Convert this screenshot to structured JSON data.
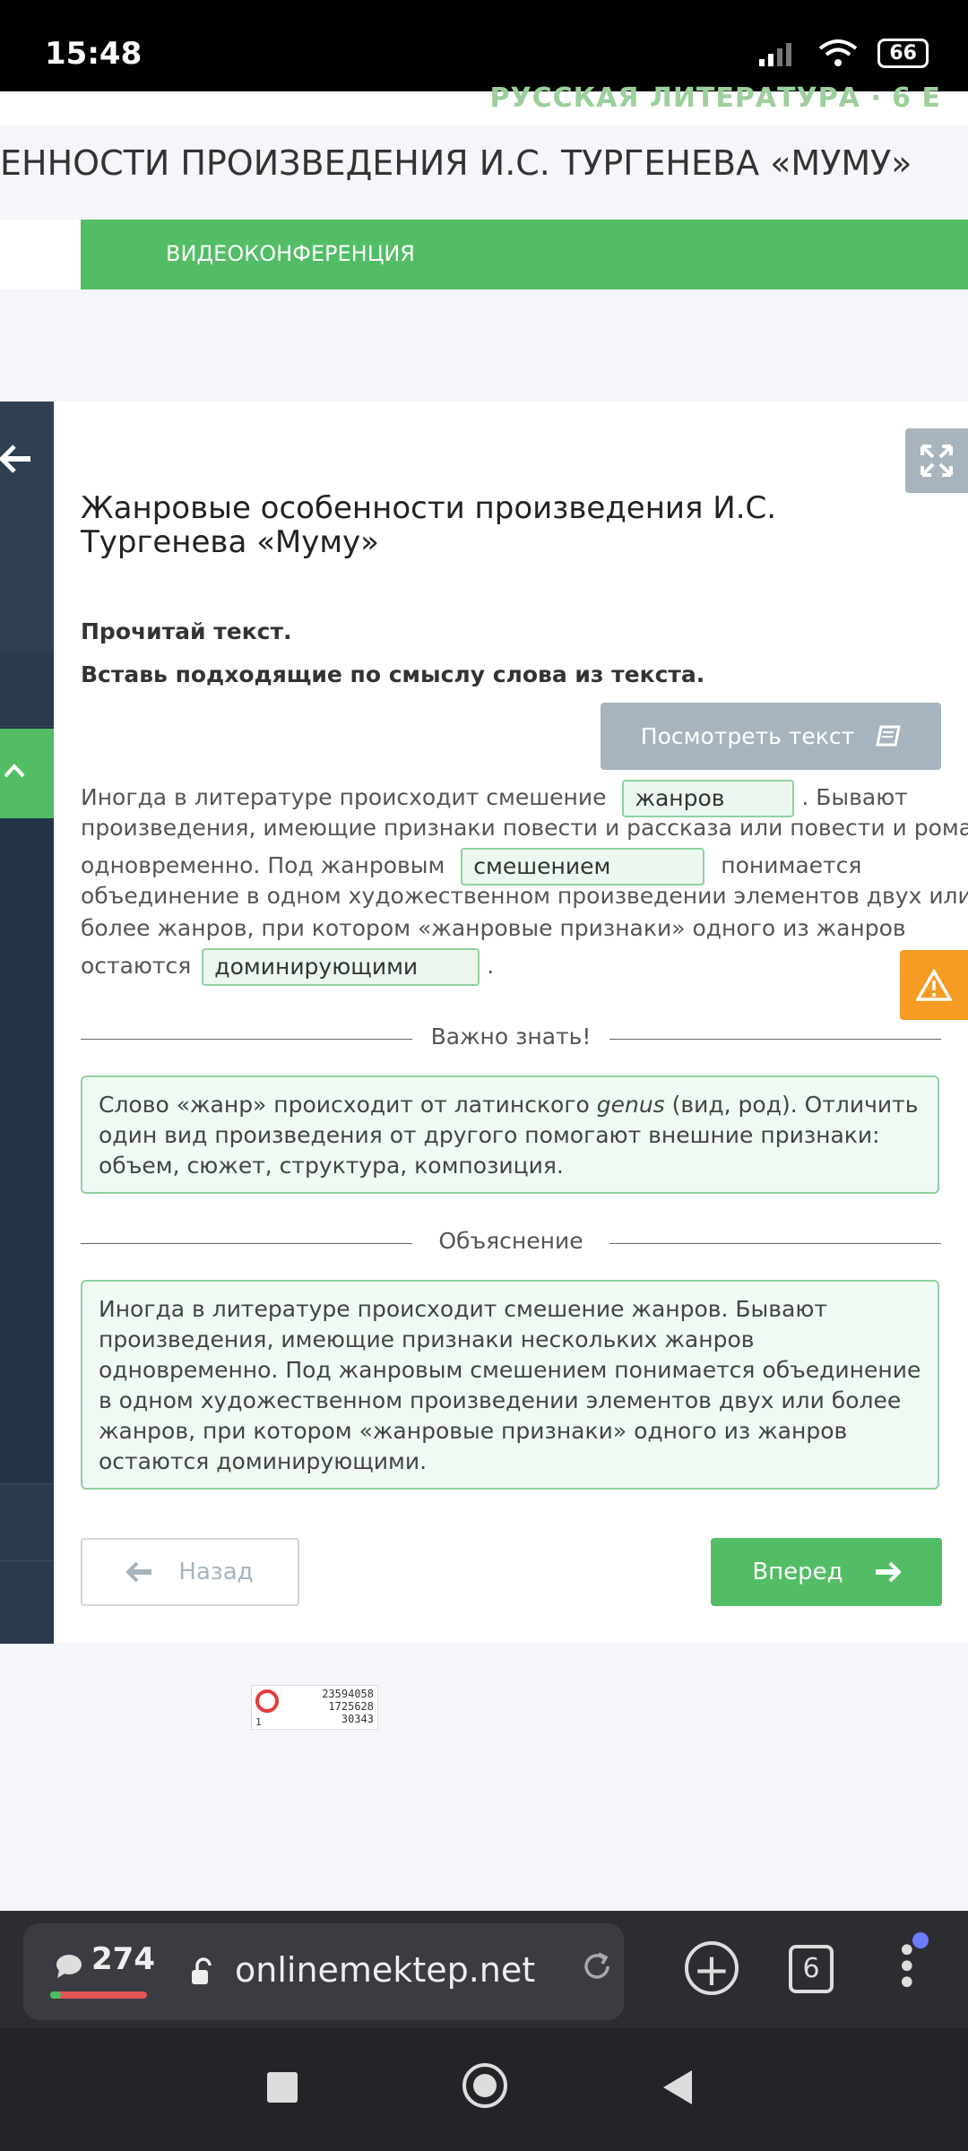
{
  "status": {
    "time": "15:48",
    "battery": "66"
  },
  "header": {
    "subject": "РУССКАЯ ЛИТЕРАТУРА · 6 Е",
    "topic": "ЕННОСТИ ПРОИЗВЕДЕНИЯ И.С. ТУРГЕНЕВА «МУМУ»",
    "tab_video": "ВИДЕОКОНФЕРЕНЦИЯ"
  },
  "lesson": {
    "title": "Жанровые особенности произведения И.С. Тургенева «Муму»",
    "instruction1": "Прочитай текст.",
    "instruction2": "Вставь подходящие по смыслу слова из текста.",
    "view_text_button": "Посмотреть текст"
  },
  "exercise": {
    "l1_a": "Иногда в литературе происходит смешение",
    "blank1": "жанров",
    "l1_b": ". Бывают",
    "l2": "произведения, имеющие признаки повести и рассказа или повести и романа",
    "l3_a": "одновременно. Под жанровым",
    "blank2": "смешением",
    "l3_b": "понимается",
    "l4": "объединение в одном художественном произведении элементов двух или",
    "l5": "более жанров, при котором «жанровые признаки» одного из жанров",
    "l6_a": "остаются",
    "blank3": "доминирующими",
    "l6_b": "."
  },
  "important": {
    "heading": "Важно знать!",
    "text_a": "Слово «жанр» происходит от латинского ",
    "text_italic": "genus",
    "text_b": " (вид, род). Отличить один вид произведения от другого помогают внешние признаки: объем, сюжет, структура, композиция."
  },
  "explanation": {
    "heading": "Объяснение",
    "text": "Иногда в литературе происходит смешение жанров. Бывают произведения, имеющие признаки нескольких жанров одновременно. Под жанровым смешением понимается объединение в одном художественном произведении элементов двух или более жанров, при котором «жанровые признаки» одного из жанров остаются доминирующими."
  },
  "nav": {
    "back": "Назад",
    "next": "Вперед"
  },
  "counter": {
    "line1": "23594058",
    "line2": "1725628",
    "line3": "30343",
    "small": "1"
  },
  "browser": {
    "chat_count": "274",
    "url": "onlinemektep.net",
    "tabs": "6"
  },
  "colors": {
    "accent": "#52bd65",
    "sidebar": "#233447",
    "warning": "#f59a23",
    "muted_button": "#a7b4bd"
  }
}
